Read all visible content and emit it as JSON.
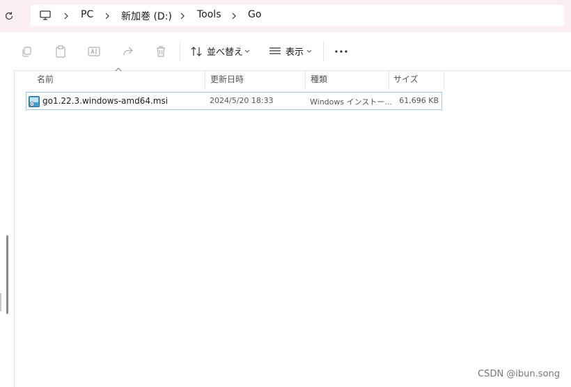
{
  "address_bar": {
    "crumbs": [
      "PC",
      "新加巻 (D:)",
      "Tools",
      "Go"
    ]
  },
  "command_bar": {
    "sort_label": "並べ替え",
    "view_label": "表示",
    "more_label": "…"
  },
  "columns": {
    "name": "名前",
    "date": "更新日時",
    "type": "種類",
    "size": "サイズ"
  },
  "files": [
    {
      "name": "go1.22.3.windows-amd64.msi",
      "date": "2024/5/20 18:33",
      "type": "Windows インストー...",
      "size": "61,696 KB"
    }
  ],
  "watermark": "CSDN @ibun.song",
  "colors": {
    "topbar_bg": "#fbeff2",
    "selection_border": "#99c9ef"
  }
}
